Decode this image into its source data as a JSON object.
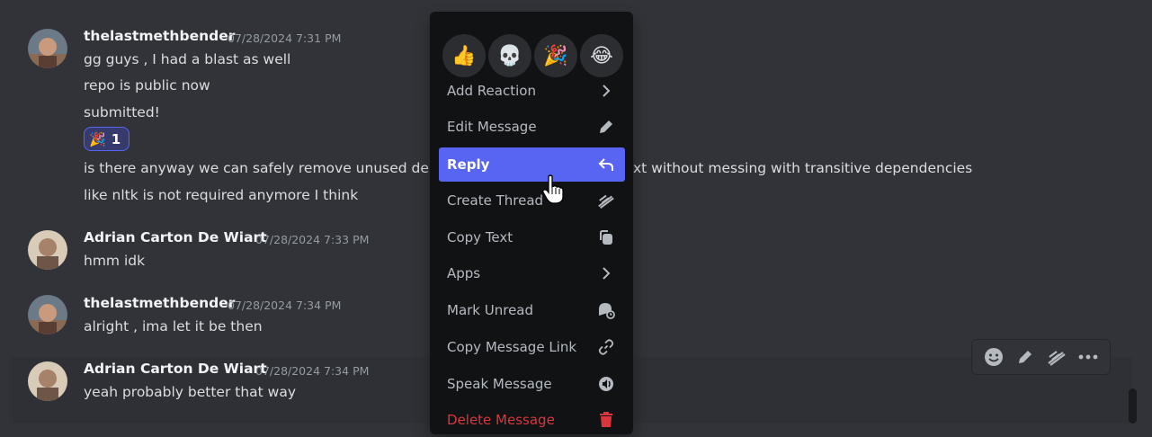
{
  "messages": [
    {
      "author": "thelastmethbender",
      "timestamp": "07/28/2024 7:31 PM",
      "lines": [
        "gg guys , I had a blast as well",
        "repo is public now",
        "submitted!"
      ],
      "reaction": {
        "emoji": "🎉",
        "count": "1"
      },
      "more_lines": [
        "is there anyway we can safely remove unused depe",
        "xt without messing with transitive dependencies",
        "like nltk is not required anymore I think"
      ]
    },
    {
      "author": "Adrian Carton De Wiart",
      "timestamp": "07/28/2024 7:33 PM",
      "lines": [
        "hmm idk"
      ]
    },
    {
      "author": "thelastmethbender",
      "timestamp": "07/28/2024 7:34 PM",
      "lines": [
        "alright , ima let it be then"
      ]
    },
    {
      "author": "Adrian Carton De Wiart",
      "timestamp": "07/28/2024 7:34 PM",
      "lines": [
        "yeah probably better that way"
      ]
    }
  ],
  "context_menu": {
    "quick_reactions": [
      "👍",
      "💀",
      "🎉",
      "😂"
    ],
    "items": [
      {
        "label": "Add Reaction",
        "icon": "chevron-right-icon"
      },
      {
        "label": "Edit Message",
        "icon": "pencil-icon"
      },
      {
        "label": "Reply",
        "icon": "reply-arrow-icon",
        "active": true
      },
      {
        "label": "Create Thread",
        "icon": "thread-icon"
      },
      {
        "label": "Copy Text",
        "icon": "copy-icon"
      },
      {
        "label": "Apps",
        "icon": "chevron-right-icon"
      },
      {
        "label": "Mark Unread",
        "icon": "mark-unread-icon"
      },
      {
        "label": "Copy Message Link",
        "icon": "link-icon"
      },
      {
        "label": "Speak Message",
        "icon": "speaker-icon"
      },
      {
        "label": "Delete Message",
        "icon": "trash-icon",
        "danger": true
      }
    ]
  },
  "colors": {
    "background": "#313338",
    "menu_bg": "#111214",
    "accent": "#5865f2",
    "danger": "#da373c",
    "text": "#dbdee1",
    "muted": "#949ba4"
  },
  "toolbar": {
    "icons": [
      "add-reaction-icon",
      "edit-icon",
      "thread-icon",
      "more-icon"
    ]
  }
}
